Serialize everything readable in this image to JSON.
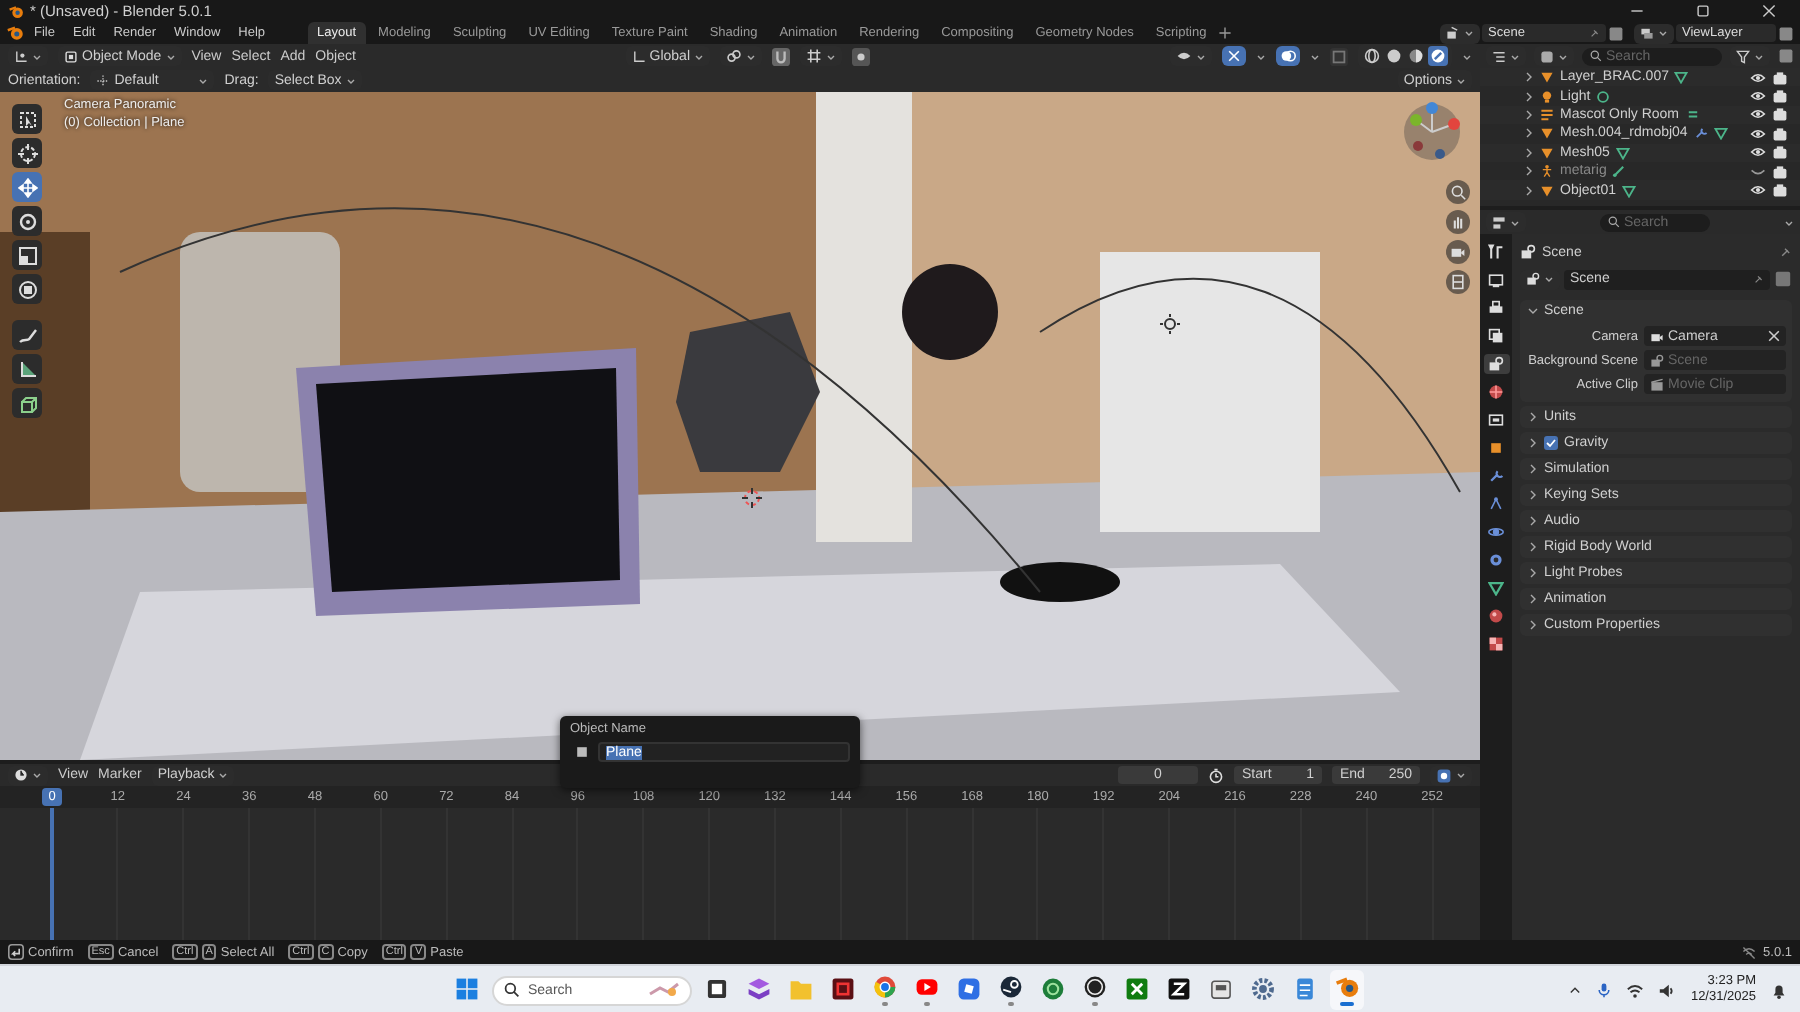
{
  "window": {
    "title": "* (Unsaved) - Blender 5.0.1"
  },
  "menu": [
    "File",
    "Edit",
    "Render",
    "Window",
    "Help"
  ],
  "workspaces": [
    {
      "label": "Layout",
      "selected": true
    },
    {
      "label": "Modeling",
      "selected": false
    },
    {
      "label": "Sculpting",
      "selected": false
    },
    {
      "label": "UV Editing",
      "selected": false
    },
    {
      "label": "Texture Paint",
      "selected": false
    },
    {
      "label": "Shading",
      "selected": false
    },
    {
      "label": "Animation",
      "selected": false
    },
    {
      "label": "Rendering",
      "selected": false
    },
    {
      "label": "Compositing",
      "selected": false
    },
    {
      "label": "Geometry Nodes",
      "selected": false
    },
    {
      "label": "Scripting",
      "selected": false
    }
  ],
  "scene_selector": {
    "scene": "Scene",
    "view_layer": "ViewLayer"
  },
  "viewport": {
    "mode": "Object Mode",
    "menus": [
      "View",
      "Select",
      "Add",
      "Object"
    ],
    "orientation_global": "Global",
    "shading": [
      {
        "kind": "wireframe",
        "selected": false
      },
      {
        "kind": "solid",
        "selected": false
      },
      {
        "kind": "material",
        "selected": false
      },
      {
        "kind": "rendered",
        "selected": true
      }
    ],
    "tool_settings": {
      "orientation_label": "Orientation:",
      "orientation": "Default",
      "drag_label": "Drag:",
      "drag": "Select Box",
      "options": "Options"
    },
    "overlay_text": [
      "Camera Panoramic",
      "(0) Collection | Plane"
    ],
    "tools": [
      {
        "kind": "select",
        "selected": false
      },
      {
        "kind": "cursor",
        "selected": false
      },
      {
        "kind": "move",
        "selected": true
      },
      {
        "kind": "rotate",
        "selected": false
      },
      {
        "kind": "scale",
        "selected": false
      },
      {
        "kind": "transform",
        "selected": false
      },
      {
        "kind": "annotate",
        "selected": false
      },
      {
        "kind": "measure",
        "selected": false
      },
      {
        "kind": "add-cube",
        "selected": false
      }
    ]
  },
  "outliner": {
    "search_placeholder": "Search",
    "items": [
      {
        "name": "Layer_BRAC.007",
        "kind": "mesh",
        "visible": true,
        "modifier": false
      },
      {
        "name": "Light",
        "kind": "light",
        "visible": true,
        "modifier": false
      },
      {
        "name": "Mascot Only Room",
        "kind": "text",
        "visible": true,
        "modifier": false
      },
      {
        "name": "Mesh.004_rdmobj04",
        "kind": "mesh",
        "visible": true,
        "modifier": true
      },
      {
        "name": "Mesh05",
        "kind": "mesh",
        "visible": true,
        "modifier": false
      },
      {
        "name": "metarig",
        "kind": "armature",
        "visible": false,
        "modifier": false
      },
      {
        "name": "Object01",
        "kind": "mesh",
        "visible": true,
        "modifier": false
      }
    ]
  },
  "properties": {
    "search_placeholder": "Search",
    "tabs": [
      {
        "kind": "tool",
        "selected": false
      },
      {
        "kind": "render",
        "selected": false
      },
      {
        "kind": "output",
        "selected": false
      },
      {
        "kind": "view-layer",
        "selected": false
      },
      {
        "kind": "scene",
        "selected": true
      },
      {
        "kind": "world",
        "selected": false
      },
      {
        "kind": "collection",
        "selected": false
      },
      {
        "kind": "object",
        "selected": false
      },
      {
        "kind": "modifiers",
        "selected": false
      },
      {
        "kind": "particles",
        "selected": false
      },
      {
        "kind": "physics",
        "selected": false
      },
      {
        "kind": "constraints",
        "selected": false
      },
      {
        "kind": "data",
        "selected": false
      },
      {
        "kind": "material",
        "selected": false
      },
      {
        "kind": "texture",
        "selected": false
      }
    ],
    "context": "Scene",
    "datablock": "Scene",
    "panels": [
      {
        "label": "Scene",
        "expanded": true,
        "fields": [
          {
            "label": "Camera",
            "kind": "camera",
            "value": "Camera"
          },
          {
            "label": "Background Scene",
            "kind": "scene",
            "placeholder": "Scene"
          },
          {
            "label": "Active Clip",
            "kind": "clip",
            "placeholder": "Movie Clip"
          }
        ]
      },
      {
        "label": "Units",
        "expanded": false
      },
      {
        "label": "Gravity",
        "expanded": false,
        "checked": true
      },
      {
        "label": "Simulation",
        "expanded": false
      },
      {
        "label": "Keying Sets",
        "expanded": false
      },
      {
        "label": "Audio",
        "expanded": false
      },
      {
        "label": "Rigid Body World",
        "expanded": false
      },
      {
        "label": "Light Probes",
        "expanded": false
      },
      {
        "label": "Animation",
        "expanded": false
      },
      {
        "label": "Custom Properties",
        "expanded": false
      }
    ]
  },
  "timeline": {
    "menus": [
      "View",
      "Marker"
    ],
    "playback": "Playback",
    "current_frame": "0",
    "start_label": "Start",
    "start": "1",
    "end_label": "End",
    "end": "250",
    "ticks": [
      {
        "label": "0",
        "current": true
      },
      {
        "label": "12",
        "current": false
      },
      {
        "label": "24",
        "current": false
      },
      {
        "label": "36",
        "current": false
      },
      {
        "label": "48",
        "current": false
      },
      {
        "label": "60",
        "current": false
      },
      {
        "label": "72",
        "current": false
      },
      {
        "label": "84",
        "current": false
      },
      {
        "label": "96",
        "current": false
      },
      {
        "label": "108",
        "current": false
      },
      {
        "label": "120",
        "current": false
      },
      {
        "label": "132",
        "current": false
      },
      {
        "label": "144",
        "current": false
      },
      {
        "label": "156",
        "current": false
      },
      {
        "label": "168",
        "current": false
      },
      {
        "label": "180",
        "current": false
      },
      {
        "label": "192",
        "current": false
      },
      {
        "label": "204",
        "current": false
      },
      {
        "label": "216",
        "current": false
      },
      {
        "label": "228",
        "current": false
      },
      {
        "label": "240",
        "current": false
      },
      {
        "label": "252",
        "current": false
      }
    ]
  },
  "popup": {
    "title": "Object Name",
    "value": "Plane"
  },
  "status_bar": {
    "hints": [
      {
        "kind": "icon",
        "label": "Confirm"
      },
      {
        "kind": "keys",
        "keys": [
          "Esc"
        ],
        "label": "Cancel"
      },
      {
        "kind": "keys",
        "keys": [
          "Ctrl",
          "A"
        ],
        "label": "Select All"
      },
      {
        "kind": "keys",
        "keys": [
          "Ctrl",
          "C"
        ],
        "label": "Copy"
      },
      {
        "kind": "keys",
        "keys": [
          "Ctrl",
          "V"
        ],
        "label": "Paste"
      }
    ],
    "version": "5.0.1"
  },
  "taskbar": {
    "search_placeholder": "Search",
    "time": "3:23 PM",
    "date": "12/31/2025",
    "apps": [
      {
        "kind": "start",
        "running": false,
        "active": false
      },
      {
        "kind": "files",
        "running": false,
        "active": false
      },
      {
        "kind": "layers",
        "running": false,
        "active": false
      },
      {
        "kind": "folder",
        "running": false,
        "active": false
      },
      {
        "kind": "red-tile",
        "running": false,
        "active": false
      },
      {
        "kind": "browser",
        "running": true,
        "active": false
      },
      {
        "kind": "video",
        "running": true,
        "active": false
      },
      {
        "kind": "blue-tile",
        "running": false,
        "active": false
      },
      {
        "kind": "steam",
        "running": true,
        "active": false
      },
      {
        "kind": "green-circle",
        "running": false,
        "active": false
      },
      {
        "kind": "record",
        "running": true,
        "active": false
      },
      {
        "kind": "game",
        "running": false,
        "active": false
      },
      {
        "kind": "cut",
        "running": false,
        "active": false
      },
      {
        "kind": "box",
        "running": false,
        "active": false
      },
      {
        "kind": "settings",
        "running": false,
        "active": false
      },
      {
        "kind": "notepad",
        "running": false,
        "active": false
      },
      {
        "kind": "blender",
        "running": true,
        "active": true
      }
    ]
  }
}
